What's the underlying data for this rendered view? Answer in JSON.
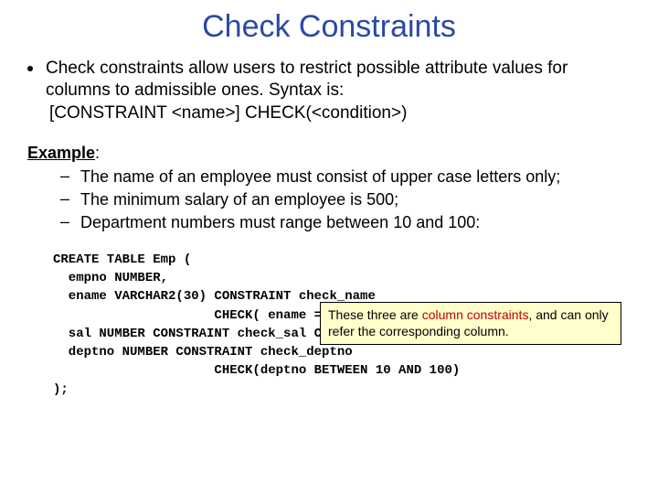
{
  "title": "Check Constraints",
  "bullet": "Check constraints allow users to restrict possible attribute values for columns to admissible ones. Syntax is:",
  "syntax": "[CONSTRAINT <name>] CHECK(<condition>)",
  "example_label": "Example",
  "example_colon": ":",
  "examples": [
    "The name of an employee must consist of upper case letters only;",
    "The minimum salary of an employee is 500;",
    "Department numbers must range between 10 and 100:"
  ],
  "callout": {
    "pre": "These three are ",
    "hl": "column constraints",
    "post": ", and can only refer the corresponding column."
  },
  "code": "CREATE TABLE Emp (\n  empno NUMBER,\n  ename VARCHAR2(30) CONSTRAINT check_name\n                     CHECK( ename = UPPER(ename) ),\n  sal NUMBER CONSTRAINT check_sal CHECK( sal >= 500 ),\n  deptno NUMBER CONSTRAINT check_deptno\n                     CHECK(deptno BETWEEN 10 AND 100)\n);"
}
